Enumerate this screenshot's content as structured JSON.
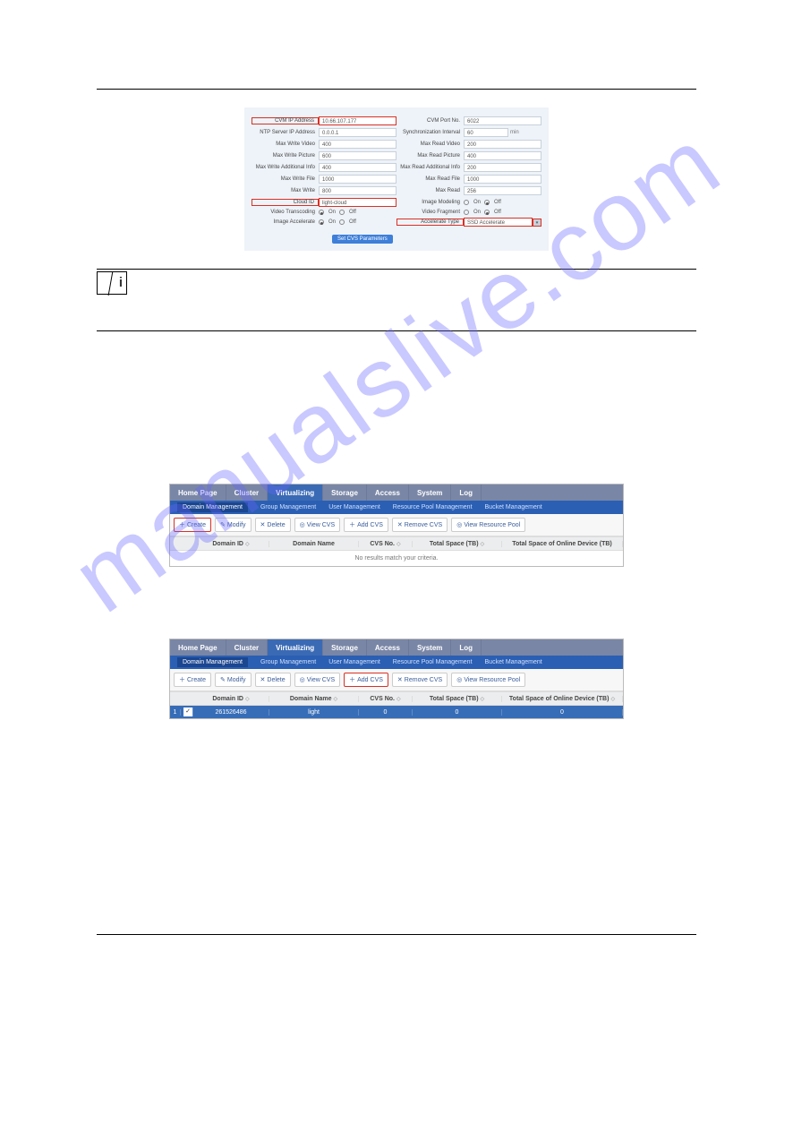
{
  "watermark": "manualslive.com",
  "form": {
    "cvm_ip_label": "CVM IP Address",
    "cvm_ip_value": "10.66.107.177",
    "cvm_port_label": "CVM Port No.",
    "cvm_port_value": "6022",
    "ntp_label": "NTP Server IP Address",
    "ntp_value": "0.0.0.1",
    "sync_label": "Synchronization Interval",
    "sync_value": "60",
    "sync_unit": "min",
    "max_write_video_label": "Max Write Video",
    "max_write_video_value": "400",
    "max_read_video_label": "Max Read Video",
    "max_read_video_value": "200",
    "max_write_picture_label": "Max Write Picture",
    "max_write_picture_value": "600",
    "max_read_picture_label": "Max Read Picture",
    "max_read_picture_value": "400",
    "max_write_add_label": "Max Write Additional Info",
    "max_write_add_value": "400",
    "max_read_add_label": "Max Read Additional Info",
    "max_read_add_value": "200",
    "max_write_file_label": "Max Write File",
    "max_write_file_value": "1000",
    "max_read_file_label": "Max Read File",
    "max_read_file_value": "1000",
    "max_write_label": "Max Write",
    "max_write_value": "800",
    "max_read_label": "Max Read",
    "max_read_value": "256",
    "cloud_id_label": "Cloud ID",
    "cloud_id_value": "light-cloud",
    "image_modeling_label": "Image Modeling",
    "video_transcoding_label": "Video Transcoding",
    "video_fragment_label": "Video Fragment",
    "image_accelerate_label": "Image Accelerate",
    "accelerate_type_label": "Accelerate Type",
    "accelerate_type_value": "SSD Accelerate",
    "on_label": "On",
    "off_label": "Off",
    "submit_label": "Set CVS Parameters"
  },
  "nav": {
    "tabs": {
      "home": "Home Page",
      "cluster": "Cluster",
      "virtualizing": "Virtualizing",
      "storage": "Storage",
      "access": "Access",
      "system": "System",
      "log": "Log"
    },
    "subnav": {
      "domain": "Domain Management",
      "group": "Group Management",
      "user": "User Management",
      "rpool": "Resource Pool Management",
      "bucket": "Bucket Management"
    },
    "toolbar": {
      "create": "Create",
      "modify": "Modify",
      "delete": "Delete",
      "viewcvs": "View CVS",
      "addcvs": "Add CVS",
      "removecvs": "Remove CVS",
      "viewrpool": "View Resource Pool"
    },
    "table": {
      "domain_id": "Domain ID",
      "domain_name": "Domain Name",
      "cvs_no": "CVS No.",
      "total_space": "Total Space (TB)",
      "total_space_online": "Total Space of Online Device (TB)",
      "no_results": "No results match your criteria."
    },
    "row": {
      "idx": "1",
      "domain_id": "261526486",
      "domain_name": "light",
      "cvs_no": "0",
      "total_space": "0",
      "total_space_online": "0"
    }
  },
  "icons": {
    "plus": "＋",
    "pencil": "✎",
    "x": "✕",
    "eye": "◎",
    "sort": "◇",
    "check": "✓",
    "down": "▾"
  }
}
